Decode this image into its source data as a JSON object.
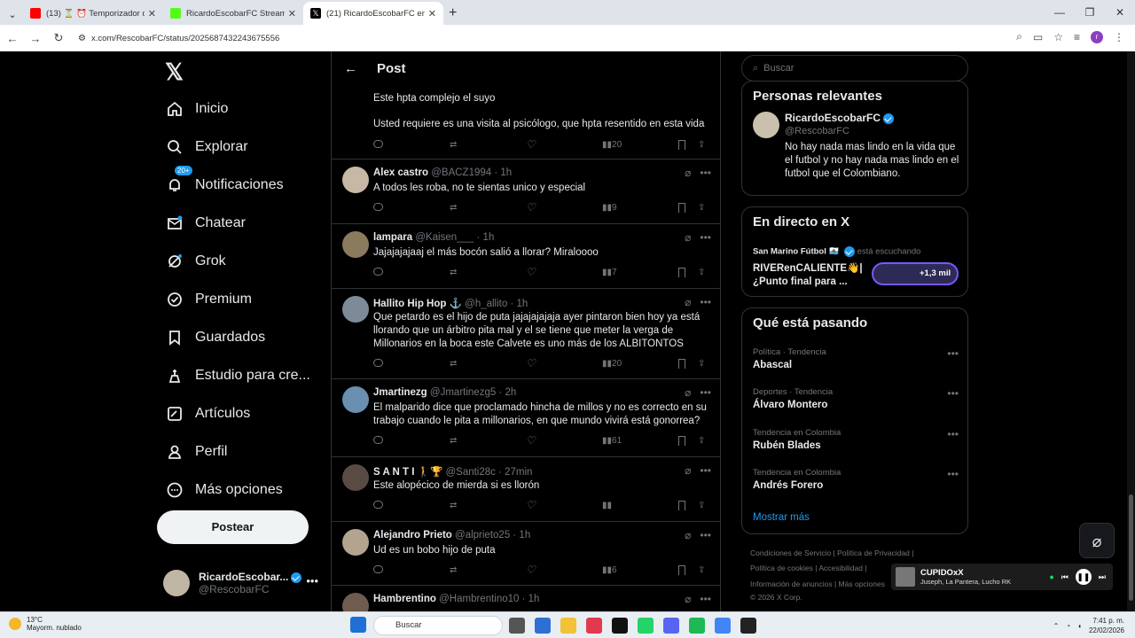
{
  "browser": {
    "tabs": [
      {
        "title": "(13) ⏳ ⏰ Temporizador de 10",
        "fav_color": "#ff0000",
        "active": false
      },
      {
        "title": "RicardoEscobarFC Stream - Wa",
        "fav_color": "#53fc18",
        "active": false
      },
      {
        "title": "(21) RicardoEscobarFC en X: \"Es",
        "fav_color": "#000000",
        "active": true
      }
    ],
    "url": "x.com/RescobarFC/status/2025687432243675556",
    "profile_letter": "r"
  },
  "nav": {
    "items": [
      {
        "label": "Inicio",
        "icon": "home-icon"
      },
      {
        "label": "Explorar",
        "icon": "search-icon"
      },
      {
        "label": "Notificaciones",
        "icon": "bell-icon"
      },
      {
        "label": "Chatear",
        "icon": "mail-icon"
      },
      {
        "label": "Grok",
        "icon": "grok-icon"
      },
      {
        "label": "Premium",
        "icon": "premium-icon"
      },
      {
        "label": "Guardados",
        "icon": "bookmark-icon"
      },
      {
        "label": "Estudio para cre...",
        "icon": "studio-icon"
      },
      {
        "label": "Artículos",
        "icon": "articles-icon"
      },
      {
        "label": "Perfil",
        "icon": "person-icon"
      },
      {
        "label": "Más opciones",
        "icon": "more-icon"
      }
    ],
    "notif_badge": "20+",
    "post_label": "Postear",
    "account_name": "RicardoEscobar...",
    "account_handle": "@RescobarFC"
  },
  "header": {
    "title": "Post"
  },
  "previous": {
    "line1": "Este hpta complejo el suyo",
    "line2": "Usted requiere es una visita al psicólogo, que hpta resentido en esta vida",
    "views": "20"
  },
  "tweets": [
    {
      "name": "Alex castro",
      "handle": "@BACZ1994 · 1h",
      "text": "A todos les roba, no te sientas unico y especial",
      "views": "9",
      "avatar": "#c7b8a6"
    },
    {
      "name": "lampara",
      "handle": "@Kaisen___ · 1h",
      "text": "Jajajajajaaj el más bocón salió a llorar? Miraloooo",
      "views": "7",
      "avatar": "#8b7a5e"
    },
    {
      "name": "Hallito Hip Hop ⚓",
      "handle": "@h_allito · 1h",
      "text": "Que petardo es el hijo de puta jajajajajaja ayer pintaron bien hoy ya está llorando que un árbitro pita mal y el se tiene que meter la verga de Millonarios en la boca este Calvete es uno más de los ALBITONTOS",
      "views": "20",
      "avatar": "#7d8b99"
    },
    {
      "name": "Jmartinezg",
      "handle": "@Jmartinezg5 · 2h",
      "text": "El malparido dice que proclamado hincha de millos y no es correcto en su trabajo cuando le pita a millonarios, en que mundo vivirá está gonorrea?",
      "views": "61",
      "avatar": "#6a8fb0"
    },
    {
      "name": "S A N T I 🚶🏆",
      "handle": "@Santi28c · 27min",
      "text": "Este alopécico de mierda si es llorón",
      "views": "",
      "avatar": "#5a4a44"
    },
    {
      "name": "Alejandro Prieto",
      "handle": "@alprieto25 · 1h",
      "text": "Ud es un bobo hijo de puta",
      "views": "6",
      "avatar": "#b2a48e"
    },
    {
      "name": "Hambrentino",
      "handle": "@Hambrentino10 · 1h",
      "text": "",
      "views": "",
      "avatar": "#6e5c4e"
    }
  ],
  "right": {
    "search_placeholder": "Buscar",
    "relevant_title": "Personas relevantes",
    "rel_name": "RicardoEscobarFC",
    "rel_handle": "@RescobarFC",
    "rel_bio": "No hay nada mas lindo en la vida que el futbol y no hay nada mas lindo en el futbol que el Colombiano.",
    "live_title": "En directo en X",
    "live_host": "San Marino Fútbol 🇸🇲",
    "live_status": "está escuchando",
    "live_space": "RIVERenCALIENTE👋| ¿Punto final para ...",
    "live_count": "+1,3 mil",
    "trends_title": "Qué está pasando",
    "trends": [
      {
        "cat": "Política · Tendencia",
        "name": "Abascal"
      },
      {
        "cat": "Deportes · Tendencia",
        "name": "Álvaro Montero"
      },
      {
        "cat": "Tendencia en Colombia",
        "name": "Rubén Blades"
      },
      {
        "cat": "Tendencia en Colombia",
        "name": "Andrés Forero"
      }
    ],
    "show_more": "Mostrar más",
    "footer": [
      "Condiciones de Servicio  |  Política de Privacidad  |",
      "Política de cookies  |  Accesibilidad  |",
      "Información de anuncios  |  Más opciones",
      "© 2026 X Corp."
    ]
  },
  "media": {
    "title": "CUPIDOxX",
    "artist": "Juseph, La Pantera, Lucho RK"
  },
  "taskbar": {
    "temp": "13°C",
    "weather": "Mayorm. nublado",
    "search": "Buscar",
    "time": "7:41 p. m.",
    "date": "22/02/2026"
  }
}
